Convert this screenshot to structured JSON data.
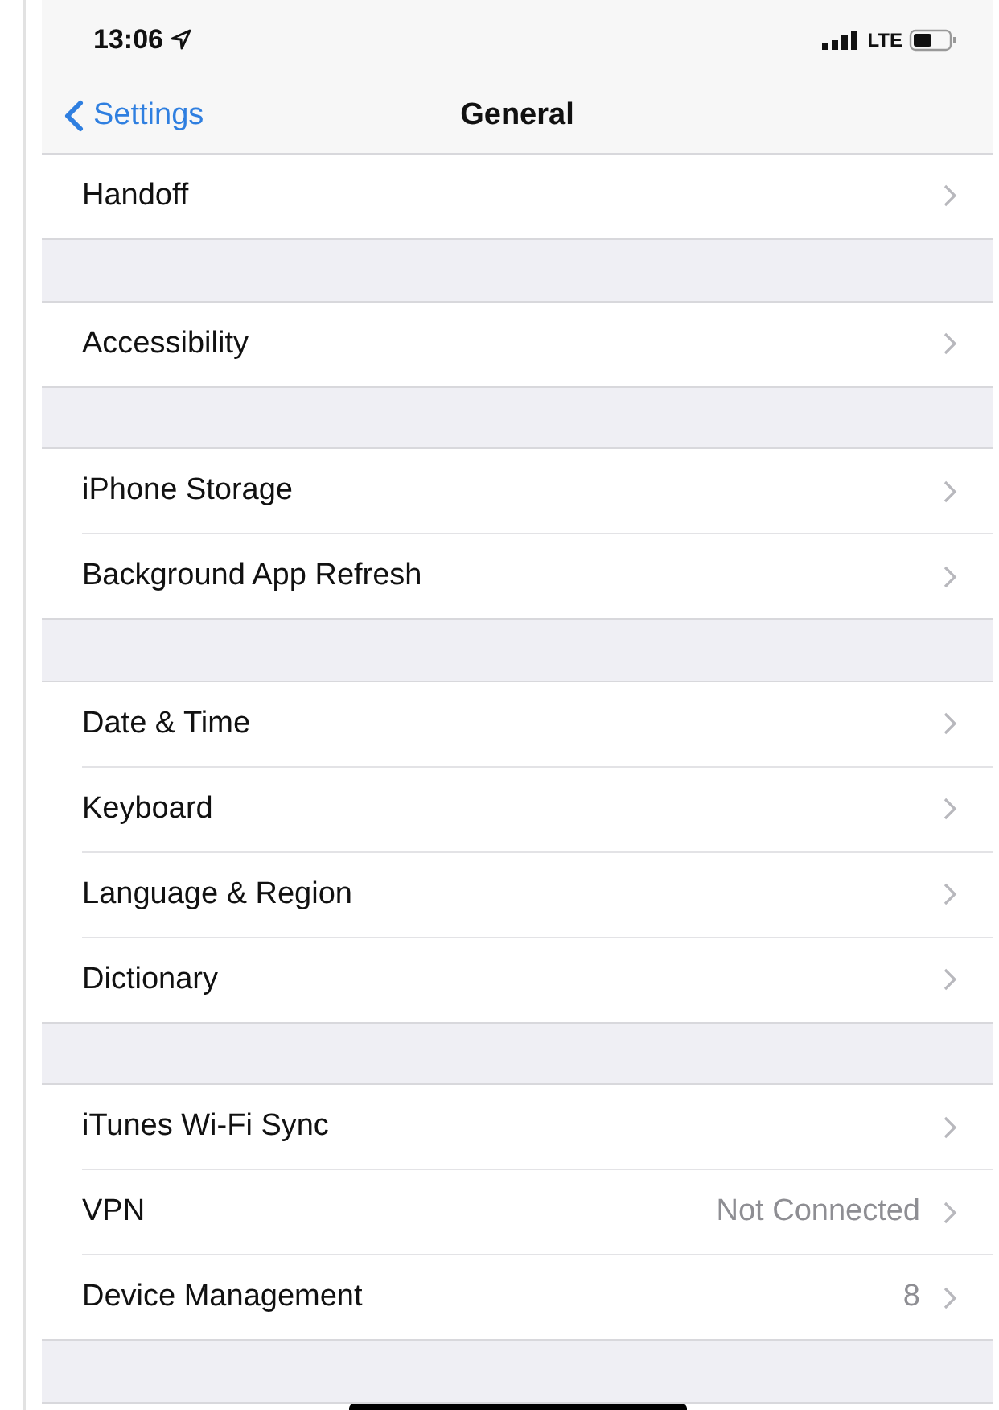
{
  "status_bar": {
    "time": "13:06",
    "network": "LTE"
  },
  "nav": {
    "back_label": "Settings",
    "title": "General"
  },
  "sections": [
    {
      "rows": [
        {
          "label": "Handoff"
        }
      ]
    },
    {
      "rows": [
        {
          "label": "Accessibility"
        }
      ]
    },
    {
      "rows": [
        {
          "label": "iPhone Storage"
        },
        {
          "label": "Background App Refresh"
        }
      ]
    },
    {
      "rows": [
        {
          "label": "Date & Time"
        },
        {
          "label": "Keyboard"
        },
        {
          "label": "Language & Region"
        },
        {
          "label": "Dictionary"
        }
      ]
    },
    {
      "rows": [
        {
          "label": "iTunes Wi-Fi Sync"
        },
        {
          "label": "VPN",
          "value": "Not Connected"
        },
        {
          "label": "Device Management",
          "value": "8"
        }
      ]
    }
  ]
}
